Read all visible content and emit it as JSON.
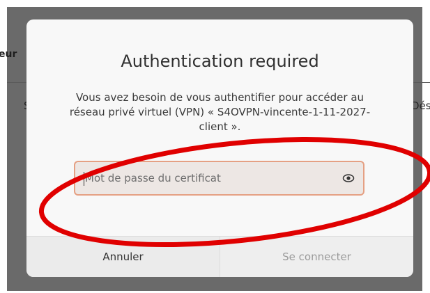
{
  "background": {
    "left_title_fragment": "eur",
    "left_tab_fragment": "S",
    "right_tab_fragment": "Dés"
  },
  "dialog": {
    "title": "Authentication required",
    "message": "Vous avez besoin de vous authentifier pour accéder au réseau privé virtuel (VPN) « S4OVPN-vincente-1-11-2027-client ».",
    "password_field": {
      "value": "",
      "placeholder": "Mot de passe du certificat",
      "icon": "eye-icon"
    },
    "buttons": {
      "cancel_label": "Annuler",
      "connect_label": "Se connecter"
    }
  },
  "colors": {
    "annotation": "#e00000",
    "field_border_focus": "#e5a083",
    "backdrop": "#6a6a6a"
  }
}
